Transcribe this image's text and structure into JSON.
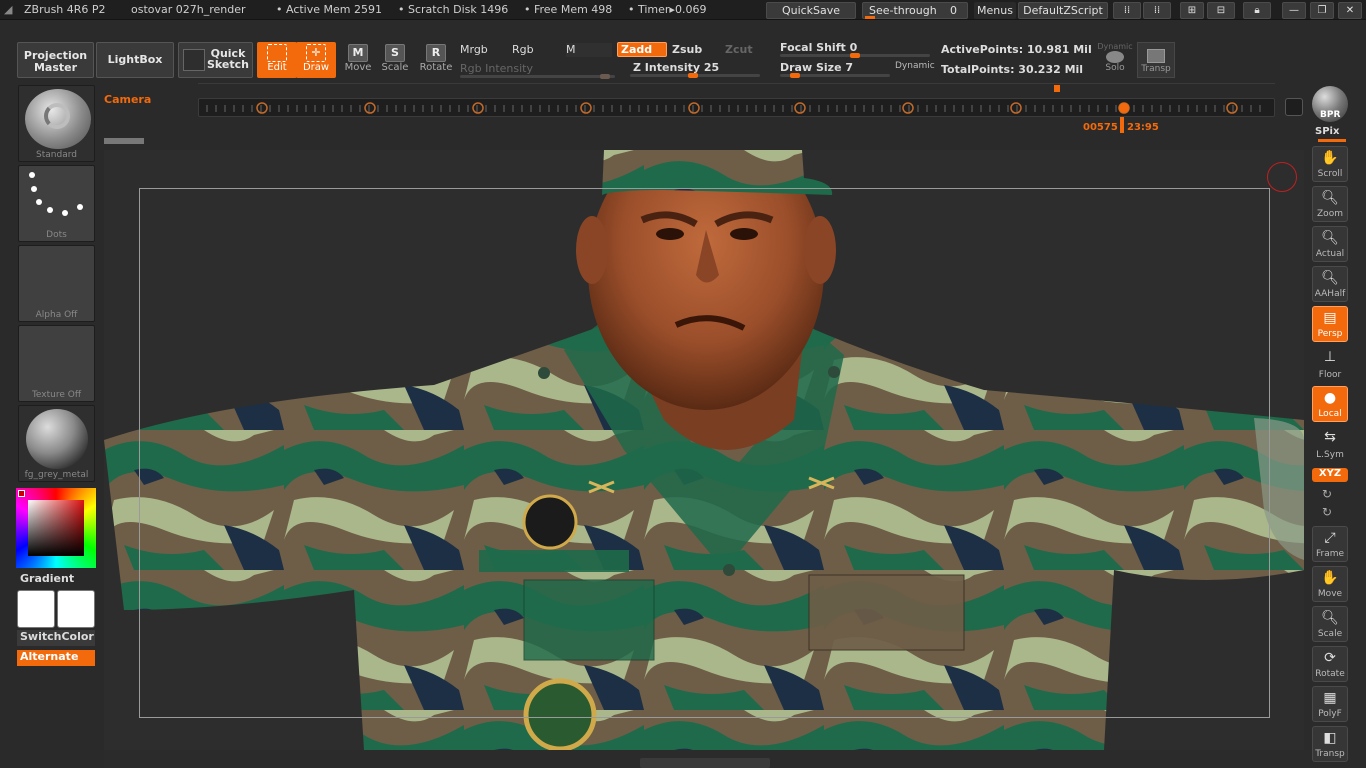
{
  "titlebar": {
    "app": "ZBrush 4R6 P2",
    "document": "ostovar 027h_render",
    "active_mem": "• Active Mem 2591",
    "scratch_disk": "• Scratch Disk 1496",
    "free_mem": "• Free Mem 498",
    "timer": "• Timer▸0.069",
    "quicksave": "QuickSave",
    "see_through_label": "See-through",
    "see_through_value": "0",
    "menus": "Menus",
    "script": "DefaultZScript"
  },
  "shelf": {
    "projection_master": "Projection Master",
    "lightbox": "LightBox",
    "quick_sketch": "Quick Sketch",
    "edit": "Edit",
    "draw": "Draw",
    "move": "Move",
    "scale": "Scale",
    "rotate": "Rotate",
    "mrgb": "Mrgb",
    "rgb": "Rgb",
    "m": "M",
    "rgb_intensity": "Rgb Intensity",
    "zadd": "Zadd",
    "zsub": "Zsub",
    "zcut": "Zcut",
    "z_intensity": "Z Intensity 25",
    "focal_shift": "Focal Shift 0",
    "draw_size": "Draw Size 7",
    "dynamic": "Dynamic",
    "active_points": "ActivePoints: 10.981 Mil",
    "total_points": "TotalPoints: 30.232 Mil",
    "dynamic_solo": "Dynamic",
    "solo": "Solo",
    "transp": "Transp"
  },
  "timeline": {
    "camera_label": "Camera",
    "frame_counter": "00575",
    "time": "23:95"
  },
  "left": {
    "brush": "Standard",
    "stroke": "Dots",
    "alpha": "Alpha Off",
    "texture": "Texture Off",
    "material": "fg_grey_metal",
    "gradient": "Gradient",
    "switch_color": "SwitchColor",
    "alternate": "Alternate"
  },
  "right": {
    "bpr": "BPR",
    "spix": "SPix",
    "scroll": "Scroll",
    "zoom": "Zoom",
    "actual": "Actual",
    "aahalf": "AAHalf",
    "persp": "Persp",
    "floor": "Floor",
    "local": "Local",
    "lsym": "L.Sym",
    "xyz": "XYZ",
    "frame": "Frame",
    "move": "Move",
    "scale": "Scale",
    "rotate": "Rotate",
    "polyf": "PolyF",
    "transp": "Transp"
  },
  "colors": {
    "accent": "#f26a0c",
    "ui_bg": "#2b2b2b",
    "camo_dark_green": "#1f6b4a",
    "camo_light": "#a8b78a",
    "camo_brown": "#6b5a45",
    "skin": "#a85a35"
  }
}
